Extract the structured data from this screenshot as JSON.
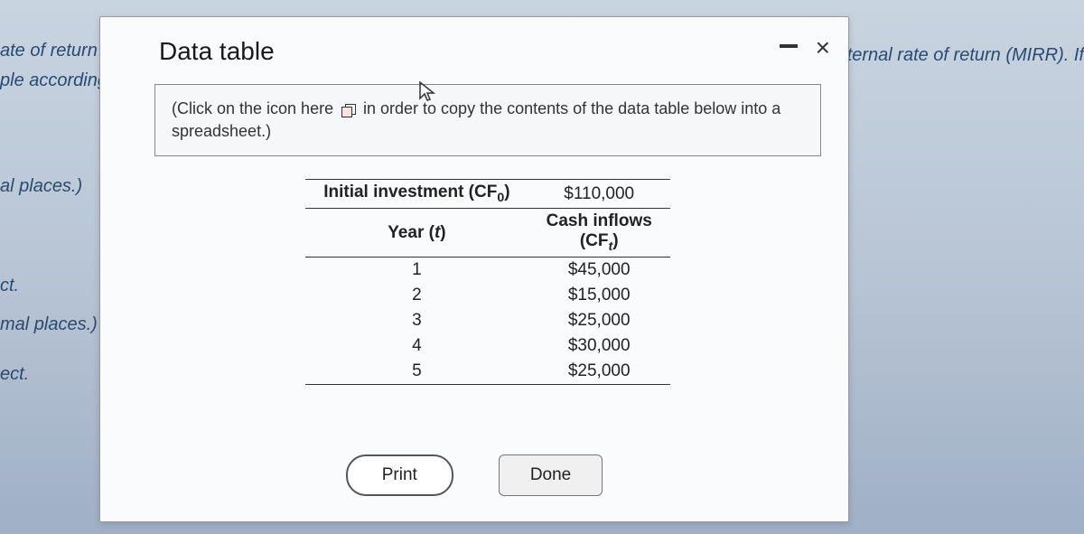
{
  "background": {
    "line1": "ate of return F",
    "line2": "ple according t",
    "line3": "al places.)",
    "line4": "ct.",
    "line5": "mal places.)",
    "line6": "ect.",
    "right": "d internal rate of return (MIRR). If"
  },
  "modal": {
    "title": "Data table",
    "instruction_pre": "(Click on the icon here",
    "instruction_post": "in order to copy the contents of the data table below into a spreadsheet.)",
    "table": {
      "header_initial_label": "Initial investment (CF",
      "header_initial_sub": "0",
      "header_initial_close": ")",
      "header_initial_value": "$110,000",
      "header_year_label": "Year (",
      "header_year_italic": "t",
      "header_year_close": ")",
      "header_cashinflows_line1": "Cash inflows",
      "header_cashinflows_line2_pre": "(CF",
      "header_cashinflows_line2_sub": "t",
      "header_cashinflows_line2_close": ")",
      "rows": [
        {
          "year": "1",
          "cf": "$45,000"
        },
        {
          "year": "2",
          "cf": "$15,000"
        },
        {
          "year": "3",
          "cf": "$25,000"
        },
        {
          "year": "4",
          "cf": "$30,000"
        },
        {
          "year": "5",
          "cf": "$25,000"
        }
      ]
    },
    "buttons": {
      "print": "Print",
      "done": "Done"
    }
  }
}
